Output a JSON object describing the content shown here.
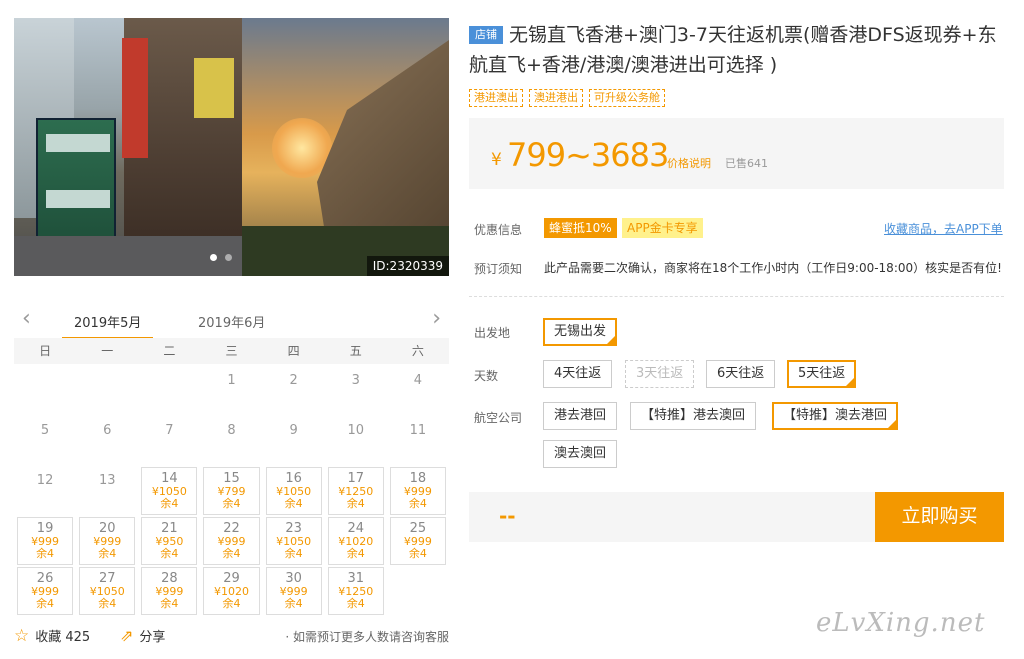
{
  "gallery": {
    "image_id": "ID:2320339"
  },
  "calendar": {
    "prev_icon": "chevron-left-icon",
    "next_icon": "chevron-right-icon",
    "months": [
      "2019年5月",
      "2019年6月"
    ],
    "weekdays": [
      "日",
      "一",
      "二",
      "三",
      "四",
      "五",
      "六"
    ],
    "days": [
      {
        "d": "",
        "p": "",
        "s": ""
      },
      {
        "d": "",
        "p": "",
        "s": ""
      },
      {
        "d": "",
        "p": "",
        "s": ""
      },
      {
        "d": "1",
        "p": "",
        "s": ""
      },
      {
        "d": "2",
        "p": "",
        "s": ""
      },
      {
        "d": "3",
        "p": "",
        "s": ""
      },
      {
        "d": "4",
        "p": "",
        "s": ""
      },
      {
        "d": "5",
        "p": "",
        "s": ""
      },
      {
        "d": "6",
        "p": "",
        "s": ""
      },
      {
        "d": "7",
        "p": "",
        "s": ""
      },
      {
        "d": "8",
        "p": "",
        "s": ""
      },
      {
        "d": "9",
        "p": "",
        "s": ""
      },
      {
        "d": "10",
        "p": "",
        "s": ""
      },
      {
        "d": "11",
        "p": "",
        "s": ""
      },
      {
        "d": "12",
        "p": "",
        "s": ""
      },
      {
        "d": "13",
        "p": "",
        "s": ""
      },
      {
        "d": "14",
        "p": "¥1050",
        "s": "余4"
      },
      {
        "d": "15",
        "p": "¥799",
        "s": "余4"
      },
      {
        "d": "16",
        "p": "¥1050",
        "s": "余4"
      },
      {
        "d": "17",
        "p": "¥1250",
        "s": "余4"
      },
      {
        "d": "18",
        "p": "¥999",
        "s": "余4"
      },
      {
        "d": "19",
        "p": "¥999",
        "s": "余4"
      },
      {
        "d": "20",
        "p": "¥999",
        "s": "余4"
      },
      {
        "d": "21",
        "p": "¥950",
        "s": "余4"
      },
      {
        "d": "22",
        "p": "¥999",
        "s": "余4"
      },
      {
        "d": "23",
        "p": "¥1050",
        "s": "余4"
      },
      {
        "d": "24",
        "p": "¥1020",
        "s": "余4"
      },
      {
        "d": "25",
        "p": "¥999",
        "s": "余4"
      },
      {
        "d": "26",
        "p": "¥999",
        "s": "余4"
      },
      {
        "d": "27",
        "p": "¥1050",
        "s": "余4"
      },
      {
        "d": "28",
        "p": "¥999",
        "s": "余4"
      },
      {
        "d": "29",
        "p": "¥1020",
        "s": "余4"
      },
      {
        "d": "30",
        "p": "¥999",
        "s": "余4"
      },
      {
        "d": "31",
        "p": "¥1250",
        "s": "余4"
      }
    ]
  },
  "footer": {
    "fav_icon": "star-icon",
    "fav_label": "收藏 425",
    "share_icon": "share-icon",
    "share_label": "分享",
    "note": "· 如需预订更多人数请咨询客服"
  },
  "product": {
    "shop_badge": "店铺",
    "title": "无锡直飞香港+澳门3-7天往返机票(赠香港DFS返现券+东航直飞+香港/港澳/澳港进出可选择 )",
    "tags": [
      "港进澳出",
      "澳进港出",
      "可升级公务舱"
    ],
    "price_currency": "¥",
    "price_range": "799~3683",
    "price_desc": "价格说明",
    "sold": "已售641",
    "promo_label": "优惠信息",
    "promo_a": "蜂蜜抵10%",
    "promo_b": "APP金卡专享",
    "app_link": "收藏商品，去APP下单",
    "notice_label": "预订须知",
    "notice_text": "此产品需要二次确认，商家将在18个工作小时内（工作日9:00-18:00）核实是否有位!"
  },
  "options": {
    "departure_label": "出发地",
    "departure": [
      "无锡出发"
    ],
    "days_label": "天数",
    "days": [
      "4天往返",
      "3天往返",
      "6天往返",
      "5天往返"
    ],
    "airline_label": "航空公司",
    "airline": [
      "港去港回",
      "【特推】港去澳回",
      "【特推】澳去港回",
      "澳去澳回"
    ]
  },
  "buy": {
    "total": "--",
    "button": "立即购买"
  },
  "watermark": "eLvXing.net",
  "colors": {
    "accent": "#f39800",
    "badge_blue": "#4a90d9"
  }
}
